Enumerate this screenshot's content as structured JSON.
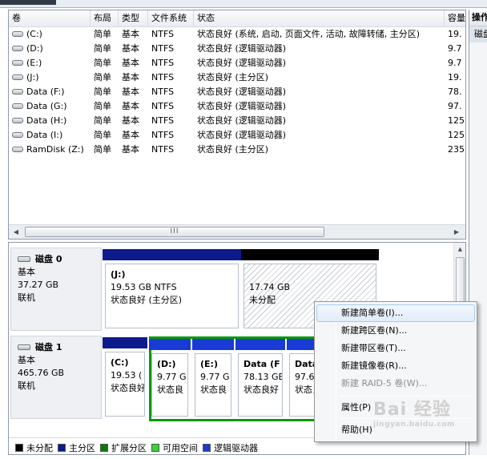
{
  "columns": [
    "卷",
    "布局",
    "类型",
    "文件系统",
    "状态",
    "容量"
  ],
  "volumes": [
    {
      "name": "(C:)",
      "layout": "简单",
      "type": "基本",
      "fs": "NTFS",
      "status": "状态良好 (系统, 启动, 页面文件, 活动, 故障转储, 主分区)",
      "capacity": "19."
    },
    {
      "name": "(D:)",
      "layout": "简单",
      "type": "基本",
      "fs": "NTFS",
      "status": "状态良好 (逻辑驱动器)",
      "capacity": "9.7"
    },
    {
      "name": "(E:)",
      "layout": "简单",
      "type": "基本",
      "fs": "NTFS",
      "status": "状态良好 (逻辑驱动器)",
      "capacity": "9.7"
    },
    {
      "name": "(J:)",
      "layout": "简单",
      "type": "基本",
      "fs": "NTFS",
      "status": "状态良好 (主分区)",
      "capacity": "19."
    },
    {
      "name": "Data (F:)",
      "layout": "简单",
      "type": "基本",
      "fs": "NTFS",
      "status": "状态良好 (逻辑驱动器)",
      "capacity": "78."
    },
    {
      "name": "Data (G:)",
      "layout": "简单",
      "type": "基本",
      "fs": "NTFS",
      "status": "状态良好 (逻辑驱动器)",
      "capacity": "97."
    },
    {
      "name": "Data (H:)",
      "layout": "简单",
      "type": "基本",
      "fs": "NTFS",
      "status": "状态良好 (逻辑驱动器)",
      "capacity": "125"
    },
    {
      "name": "Data (I:)",
      "layout": "简单",
      "type": "基本",
      "fs": "NTFS",
      "status": "状态良好 (逻辑驱动器)",
      "capacity": "125"
    },
    {
      "name": "RamDisk (Z:)",
      "layout": "简单",
      "type": "基本",
      "fs": "NTFS",
      "status": "状态良好 (主分区)",
      "capacity": "235"
    }
  ],
  "hscroll_grip": "III",
  "disks": [
    {
      "name": "磁盘 0",
      "type": "基本",
      "size": "37.27 GB",
      "state": "联机",
      "partitions": [
        {
          "title": "(J:)",
          "line1": "19.53 GB NTFS",
          "line2": "状态良好 (主分区)",
          "bar_color": "#0c1a8c",
          "hatched": false
        },
        {
          "title": "",
          "line1": "17.74 GB",
          "line2": "未分配",
          "bar_color": "#000000",
          "hatched": true
        }
      ]
    },
    {
      "name": "磁盘 1",
      "type": "基本",
      "size": "465.76 GB",
      "state": "联机",
      "partitions": [
        {
          "title": "(C:)",
          "line1": "19.53 (",
          "line2": "状态良好",
          "bar_color": "#0c1a8c",
          "hatched": false
        },
        {
          "title": "(D:)",
          "line1": "9.77 G",
          "line2": "状态良",
          "bar_color": "#1a3ad6",
          "hatched": false
        },
        {
          "title": "(E:)",
          "line1": "9.77 G",
          "line2": "状态良",
          "bar_color": "#1a3ad6",
          "hatched": false
        },
        {
          "title": "Data (F",
          "line1": "78.13 GE",
          "line2": "状态良好",
          "bar_color": "#1a3ad6",
          "hatched": false
        },
        {
          "title": "Data",
          "line1": "97.66",
          "line2": "状态良",
          "bar_color": "#1a3ad6",
          "hatched": false
        }
      ]
    }
  ],
  "legend": [
    {
      "label": "未分配",
      "color": "#000000"
    },
    {
      "label": "主分区",
      "color": "#0c1a8c"
    },
    {
      "label": "扩展分区",
      "color": "#0a7a0a"
    },
    {
      "label": "可用空间",
      "color": "#36d336"
    },
    {
      "label": "逻辑驱动器",
      "color": "#1a3ad6"
    }
  ],
  "extended_color": "#0a9a0a",
  "actions": {
    "header": "操作",
    "sub": "磁盘"
  },
  "context_menu": [
    {
      "label": "新建简单卷(I)...",
      "disabled": false,
      "highlighted": true
    },
    {
      "label": "新建跨区卷(N)...",
      "disabled": false,
      "highlighted": false
    },
    {
      "label": "新建带区卷(T)...",
      "disabled": false,
      "highlighted": false
    },
    {
      "label": "新建镜像卷(R)...",
      "disabled": false,
      "highlighted": false
    },
    {
      "label": "新建 RAID-5 卷(W)...",
      "disabled": true,
      "highlighted": false
    },
    {
      "label": "属性(P)",
      "disabled": false,
      "highlighted": false
    },
    {
      "label": "帮助(H)",
      "disabled": false,
      "highlighted": false
    }
  ],
  "watermark": {
    "main": "Bai 经验",
    "sub": "jingyan.baidu.com"
  }
}
